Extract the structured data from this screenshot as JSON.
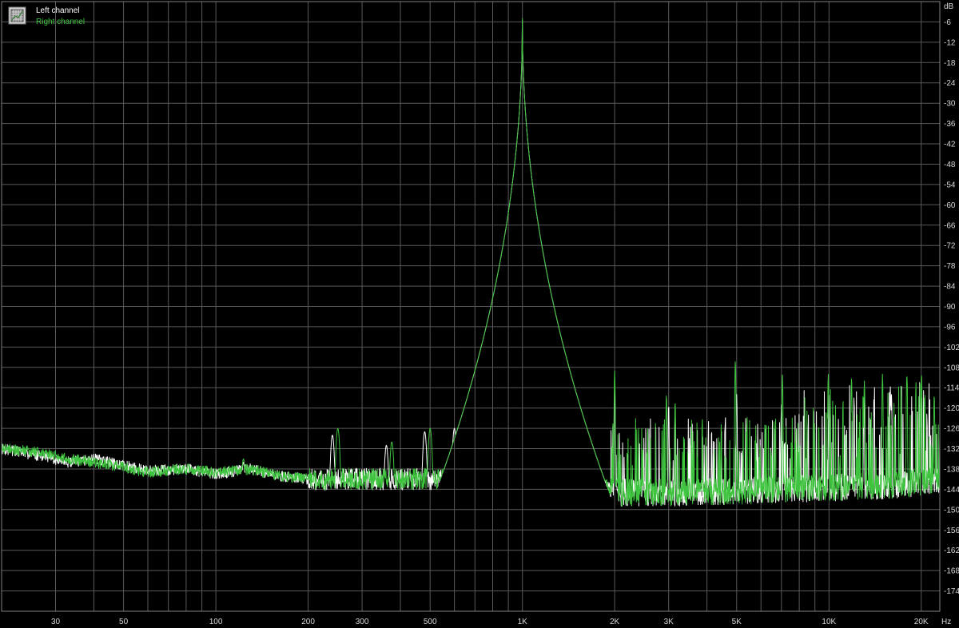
{
  "chart_data": {
    "type": "line",
    "title": "",
    "xlabel": "",
    "ylabel": "",
    "x_scale": "log",
    "x_unit": "Hz",
    "y_unit": "dB",
    "xlim": [
      20,
      23000
    ],
    "ylim": [
      -180,
      0
    ],
    "grid": true,
    "x_ticks": [
      30,
      50,
      100,
      200,
      300,
      500,
      1000,
      2000,
      3000,
      5000,
      10000,
      20000
    ],
    "x_tick_labels": [
      "30",
      "50",
      "100",
      "200",
      "300",
      "500",
      "1K",
      "2K",
      "3K",
      "5K",
      "10K",
      "20K"
    ],
    "y_ticks": [
      -6,
      -12,
      -18,
      -24,
      -30,
      -36,
      -42,
      -48,
      -54,
      -60,
      -66,
      -72,
      -78,
      -84,
      -90,
      -96,
      -102,
      -108,
      -114,
      -120,
      -126,
      -132,
      -138,
      -144,
      -150,
      -156,
      -162,
      -168,
      -174
    ],
    "y_tick_labels": [
      "-6",
      "-12",
      "-18",
      "-24",
      "-30",
      "-36",
      "-42",
      "-48",
      "-54",
      "-60",
      "-66",
      "-72",
      "-78",
      "-84",
      "-90",
      "-96",
      "-102",
      "-108",
      "-114",
      "-120",
      "-126",
      "-132",
      "-138",
      "-144",
      "-150",
      "-156",
      "-162",
      "-168",
      "-174"
    ],
    "legend_position": "top-left",
    "fundamental": {
      "x": 1000,
      "y": -5
    },
    "series": [
      {
        "name": "Left channel",
        "color": "#ffffff",
        "noise": [
          {
            "x": 20,
            "y": -132
          },
          {
            "x": 26,
            "y": -134
          },
          {
            "x": 33,
            "y": -136
          },
          {
            "x": 40,
            "y": -135
          },
          {
            "x": 50,
            "y": -137
          },
          {
            "x": 60,
            "y": -138.5
          },
          {
            "x": 80,
            "y": -138
          },
          {
            "x": 100,
            "y": -139.5
          },
          {
            "x": 130,
            "y": -138
          },
          {
            "x": 160,
            "y": -140
          },
          {
            "x": 200,
            "y": -141
          },
          {
            "x": 300,
            "y": -141
          },
          {
            "x": 400,
            "y": -141
          },
          {
            "x": 600,
            "y": -141
          },
          {
            "x": 800,
            "y": -140
          },
          {
            "x": 900,
            "y": -138
          },
          {
            "x": 950,
            "y": -134
          },
          {
            "x": 980,
            "y": -120
          },
          {
            "x": 1020,
            "y": -120
          },
          {
            "x": 1050,
            "y": -134
          },
          {
            "x": 1100,
            "y": -139
          },
          {
            "x": 1200,
            "y": -142
          },
          {
            "x": 1500,
            "y": -144
          },
          {
            "x": 2000,
            "y": -145
          },
          {
            "x": 3000,
            "y": -145
          },
          {
            "x": 5000,
            "y": -144.5
          },
          {
            "x": 10000,
            "y": -143.5
          },
          {
            "x": 15000,
            "y": -143
          },
          {
            "x": 20000,
            "y": -142
          },
          {
            "x": 23000,
            "y": -141
          }
        ],
        "peaks": [
          {
            "x": 50,
            "y": -136
          },
          {
            "x": 123,
            "y": -136
          },
          {
            "x": 240,
            "y": -128
          },
          {
            "x": 360,
            "y": -131
          },
          {
            "x": 480,
            "y": -127
          },
          {
            "x": 600,
            "y": -126
          },
          {
            "x": 850,
            "y": -128
          },
          {
            "x": 2000,
            "y": -115
          },
          {
            "x": 3000,
            "y": -119
          },
          {
            "x": 5000,
            "y": -116
          },
          {
            "x": 7000,
            "y": -119
          },
          {
            "x": 10000,
            "y": -116
          },
          {
            "x": 13000,
            "y": -121
          },
          {
            "x": 16000,
            "y": -116
          },
          {
            "x": 20000,
            "y": -116
          }
        ]
      },
      {
        "name": "Right channel",
        "color": "#3fc43f",
        "noise": [
          {
            "x": 20,
            "y": -132
          },
          {
            "x": 26,
            "y": -133
          },
          {
            "x": 33,
            "y": -135
          },
          {
            "x": 40,
            "y": -136
          },
          {
            "x": 50,
            "y": -137.5
          },
          {
            "x": 60,
            "y": -139
          },
          {
            "x": 80,
            "y": -138
          },
          {
            "x": 100,
            "y": -139
          },
          {
            "x": 130,
            "y": -138
          },
          {
            "x": 160,
            "y": -140
          },
          {
            "x": 200,
            "y": -141
          },
          {
            "x": 300,
            "y": -141
          },
          {
            "x": 400,
            "y": -141
          },
          {
            "x": 600,
            "y": -141
          },
          {
            "x": 800,
            "y": -140
          },
          {
            "x": 900,
            "y": -138
          },
          {
            "x": 950,
            "y": -134
          },
          {
            "x": 980,
            "y": -120
          },
          {
            "x": 1020,
            "y": -120
          },
          {
            "x": 1050,
            "y": -134
          },
          {
            "x": 1100,
            "y": -139
          },
          {
            "x": 1200,
            "y": -142
          },
          {
            "x": 1500,
            "y": -144
          },
          {
            "x": 2000,
            "y": -145
          },
          {
            "x": 3000,
            "y": -145
          },
          {
            "x": 5000,
            "y": -144.5
          },
          {
            "x": 10000,
            "y": -143.5
          },
          {
            "x": 15000,
            "y": -143
          },
          {
            "x": 20000,
            "y": -142
          },
          {
            "x": 23000,
            "y": -141
          }
        ],
        "peaks": [
          {
            "x": 123,
            "y": -135
          },
          {
            "x": 250,
            "y": -126
          },
          {
            "x": 375,
            "y": -130
          },
          {
            "x": 500,
            "y": -126
          },
          {
            "x": 625,
            "y": -125
          },
          {
            "x": 875,
            "y": -128
          },
          {
            "x": 1050,
            "y": -120
          },
          {
            "x": 1100,
            "y": -124
          },
          {
            "x": 2000,
            "y": -109
          },
          {
            "x": 2950,
            "y": -116
          },
          {
            "x": 3150,
            "y": -118
          },
          {
            "x": 4950,
            "y": -106
          },
          {
            "x": 7050,
            "y": -110
          },
          {
            "x": 9950,
            "y": -110
          },
          {
            "x": 11850,
            "y": -111
          },
          {
            "x": 13050,
            "y": -112
          },
          {
            "x": 14950,
            "y": -110
          },
          {
            "x": 17950,
            "y": -110
          },
          {
            "x": 20050,
            "y": -110
          },
          {
            "x": 22050,
            "y": -116
          }
        ]
      }
    ]
  },
  "legend": {
    "items": [
      {
        "label": "Left channel",
        "color": "#ffffff"
      },
      {
        "label": "Right channel",
        "color": "#3fc43f"
      }
    ]
  },
  "axis_units": {
    "y": "dB",
    "x": "Hz"
  }
}
